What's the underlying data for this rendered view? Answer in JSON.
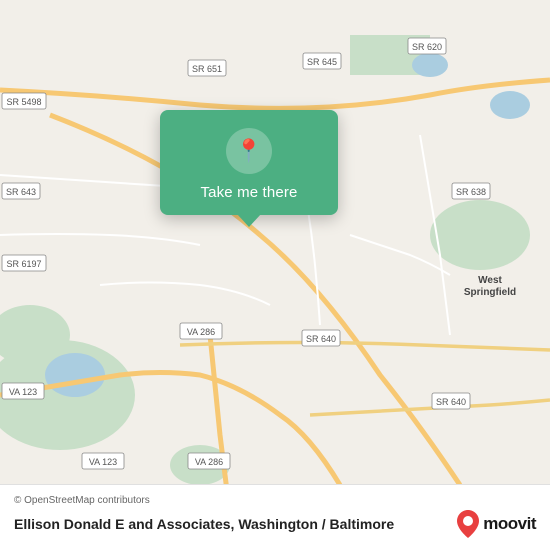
{
  "map": {
    "background_color": "#f2efe9",
    "center_lat": 38.77,
    "center_lon": -77.18
  },
  "popup": {
    "label": "Take me there",
    "icon": "location-pin"
  },
  "bottom_bar": {
    "attribution": "© OpenStreetMap contributors",
    "title": "Ellison Donald E and Associates, Washington / Baltimore",
    "moovit_label": "moovit"
  },
  "road_labels": [
    {
      "id": "sr620",
      "text": "SR 620"
    },
    {
      "id": "sr651",
      "text": "SR 651"
    },
    {
      "id": "sr645",
      "text": "SR 645"
    },
    {
      "id": "sr5498",
      "text": "SR 5498"
    },
    {
      "id": "sr638",
      "text": "SR 638"
    },
    {
      "id": "sr643",
      "text": "SR 643"
    },
    {
      "id": "sr6197",
      "text": "SR 6197"
    },
    {
      "id": "va286a",
      "text": "VA 286"
    },
    {
      "id": "va286b",
      "text": "VA 286"
    },
    {
      "id": "va123a",
      "text": "VA 123"
    },
    {
      "id": "va123b",
      "text": "VA 123"
    },
    {
      "id": "sr640a",
      "text": "SR 640"
    },
    {
      "id": "sr640b",
      "text": "SR 640"
    },
    {
      "id": "west_springfield",
      "text": "West Springfield"
    }
  ]
}
